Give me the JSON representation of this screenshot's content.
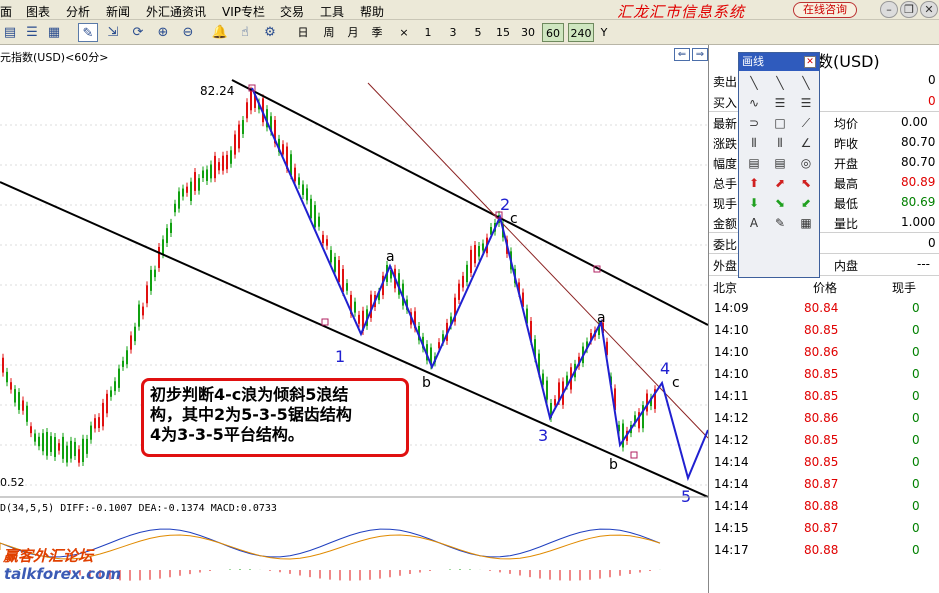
{
  "menu": [
    "面",
    "图表",
    "分析",
    "新闻",
    "外汇通资讯",
    "VIP专栏",
    "交易",
    "工具",
    "帮助"
  ],
  "brand": "汇龙汇市信息系统",
  "online_button": "在线咨询",
  "periods": [
    "日",
    "周",
    "月",
    "季",
    "×",
    "1",
    "3",
    "5",
    "15",
    "30",
    "60",
    "240",
    "Y"
  ],
  "chart": {
    "title": "元指数(USD)<60分>",
    "high_label": "82.24",
    "low_label": "0.52",
    "macd_label": "D(34,5,5) DIFF:-0.1007 DEA:-0.1374 MACD:0.0733",
    "wave_labels": [
      "1",
      "2",
      "3",
      "4",
      "5",
      "a",
      "b",
      "c",
      "a",
      "b",
      "c"
    ],
    "annotation_lines": [
      "初步判断4-c浪为倾斜5浪结",
      "构，其中2为5-3-5锯齿结构",
      "4为3-3-5平台结构。"
    ]
  },
  "draw_panel": {
    "title": "画线"
  },
  "quote": {
    "title": "数(USD)",
    "rows": [
      {
        "label": "卖出",
        "value": "0"
      },
      {
        "label": "买入",
        "value": "0"
      }
    ],
    "stats": [
      {
        "l1": "最新",
        "v1": "",
        "l2": "均价",
        "v2": "0.00"
      },
      {
        "l1": "涨跌",
        "v1": "",
        "l2": "昨收",
        "v2": "80.70"
      },
      {
        "l1": "幅度",
        "v1": "",
        "l2": "开盘",
        "v2": "80.70"
      },
      {
        "l1": "总手",
        "v1": "",
        "l2": "最高",
        "v2": "80.89"
      },
      {
        "l1": "现手",
        "v1": "",
        "l2": "最低",
        "v2": "80.69"
      },
      {
        "l1": "金额",
        "v1": "",
        "l2": "量比",
        "v2": "1.000"
      }
    ],
    "extra_rows": [
      {
        "label": "委比",
        "value": "0"
      },
      {
        "label": "外盘",
        "l2": "内盘",
        "v2": "---"
      }
    ],
    "tick_header": {
      "time": "北京",
      "price": "价格",
      "vol": "现手"
    },
    "ticks": [
      {
        "time": "14:09",
        "price": "80.84",
        "vol": "0"
      },
      {
        "time": "14:10",
        "price": "80.85",
        "vol": "0"
      },
      {
        "time": "14:10",
        "price": "80.86",
        "vol": "0"
      },
      {
        "time": "14:10",
        "price": "80.85",
        "vol": "0"
      },
      {
        "time": "14:11",
        "price": "80.85",
        "vol": "0"
      },
      {
        "time": "14:12",
        "price": "80.86",
        "vol": "0"
      },
      {
        "time": "14:12",
        "price": "80.85",
        "vol": "0"
      },
      {
        "time": "14:14",
        "price": "80.85",
        "vol": "0"
      },
      {
        "time": "14:14",
        "price": "80.87",
        "vol": "0"
      },
      {
        "time": "14:14",
        "price": "80.88",
        "vol": "0"
      },
      {
        "time": "14:15",
        "price": "80.87",
        "vol": "0"
      },
      {
        "time": "14:17",
        "price": "80.88",
        "vol": "0"
      },
      {
        "time": "",
        "price": "",
        "vol": ""
      }
    ]
  },
  "watermark": "赢客外汇论坛",
  "watermark_url": "talkforex.com"
}
